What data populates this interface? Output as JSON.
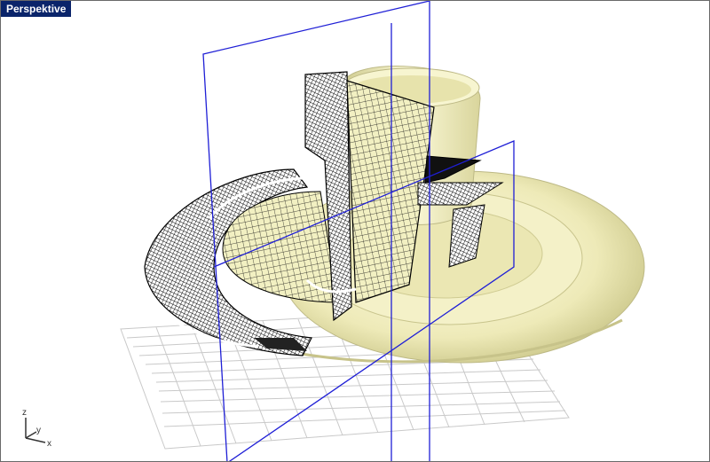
{
  "viewport": {
    "title": "Perspektive"
  },
  "axes_widget": {
    "z_label": "z",
    "y_label": "y",
    "x_label": "x"
  },
  "colors": {
    "title_bg": "#0a246a",
    "title_text": "#ffffff",
    "background": "#ffffff",
    "clipping_plane": "#1f1fd6",
    "object_fill": "#f2f0c2",
    "object_shade": "#d8d49a",
    "wire": "#111111",
    "grid": "#c9c9c9",
    "x_axis": "#b31b1b",
    "y_axis": "#2d9a2d"
  }
}
